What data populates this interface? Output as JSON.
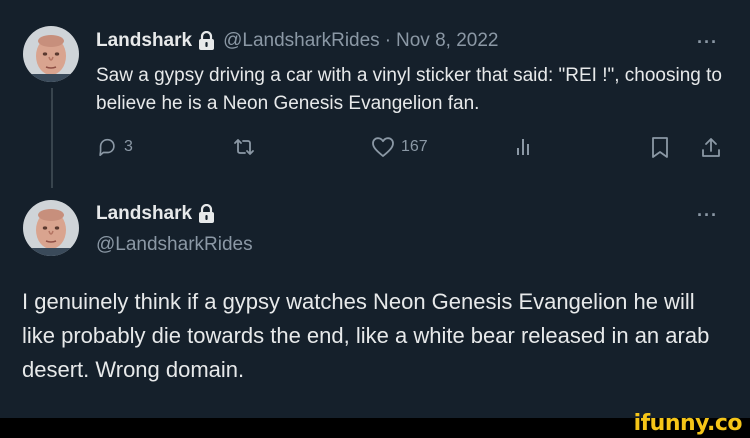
{
  "tweet": {
    "display_name": "Landshark",
    "handle": "@LandsharkRides",
    "separator": "·",
    "date": "Nov 8, 2022",
    "more": "···",
    "text": "Saw a gypsy driving a car with a vinyl sticker that said: \"REI !\", choosing to believe he is a Neon Genesis Evangelion fan.",
    "actions": {
      "replies": "3",
      "likes": "167"
    }
  },
  "reply": {
    "display_name": "Landshark",
    "handle": "@LandsharkRides",
    "more": "···",
    "text": "I genuinely think if a gypsy watches Neon Genesis Evangelion he will like probably die towards the end, like a white bear released in an arab desert. Wrong domain."
  },
  "watermark": "ifunny.co",
  "colors": {
    "background": "#15202b",
    "text": "#e7e9ea",
    "muted": "#8b98a5",
    "watermark": "#f5c518"
  },
  "icons": {
    "lock": "lock-icon",
    "reply": "reply-icon",
    "retweet": "retweet-icon",
    "like": "heart-icon",
    "views": "views-icon",
    "bookmark": "bookmark-icon",
    "share": "share-icon"
  }
}
